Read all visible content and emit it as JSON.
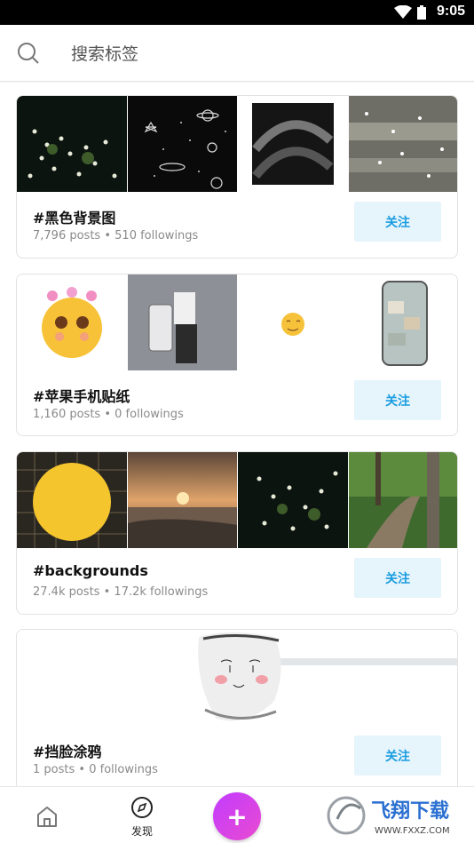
{
  "status_bar": {
    "time": "9:05"
  },
  "search": {
    "placeholder": "搜索标签"
  },
  "tags": [
    {
      "title": "#黑色背景图",
      "posts": "7,796 posts",
      "followings": "510 followings",
      "follow_label": "关注"
    },
    {
      "title": "#苹果手机贴纸",
      "posts": "1,160 posts",
      "followings": "0 followings",
      "follow_label": "关注"
    },
    {
      "title": "#backgrounds",
      "posts": "27.4k posts",
      "followings": "17.2k followings",
      "follow_label": "关注"
    },
    {
      "title": "#挡脸涂鸦",
      "posts": "1 posts",
      "followings": "0 followings",
      "follow_label": "关注"
    }
  ],
  "meta_separator": "•",
  "bottom_nav": {
    "discover_label": "发现",
    "fab_label": "+"
  },
  "watermark": {
    "line1": "飞翔下载",
    "line2": "WWW.FXXZ.COM"
  },
  "colors": {
    "follow_bg": "#e6f4fc",
    "follow_text": "#1a9de0",
    "fab": "#d444f0"
  },
  "icons": [
    "search-icon",
    "home-icon",
    "compass-icon",
    "plus-icon",
    "wifi-icon",
    "battery-icon"
  ]
}
